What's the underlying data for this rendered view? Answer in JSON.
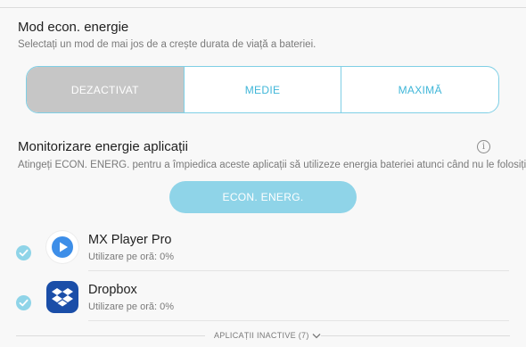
{
  "power_mode": {
    "title": "Mod econ. energie",
    "description": "Selectați un mod de mai jos de a crește durata de viață a bateriei.",
    "options": [
      {
        "label": "DEZACTIVAT",
        "selected": true
      },
      {
        "label": "MEDIE",
        "selected": false
      },
      {
        "label": "MAXIMĂ",
        "selected": false
      }
    ]
  },
  "app_monitor": {
    "title": "Monitorizare energie aplicații",
    "description": "Atingeți ECON. ENERG. pentru a împiedica aceste aplicații să utilizeze energia bateriei atunci când nu le folosiți.",
    "info_icon": "info-icon",
    "save_button_label": "ECON. ENERG."
  },
  "apps": [
    {
      "name": "MX Player Pro",
      "usage": "Utilizare pe oră: 0%",
      "checked": true,
      "icon": "play-icon"
    },
    {
      "name": "Dropbox",
      "usage": "Utilizare pe oră: 0%",
      "checked": true,
      "icon": "dropbox-icon"
    }
  ],
  "inactive_apps_label": "APLICAȚII INACTIVE (7)",
  "colors": {
    "accent": "#3fb6d8",
    "accent_light": "#8fd4e8",
    "selected_segment": "#c6c6c6",
    "mx_player_blue": "#3d8ee8",
    "dropbox_dark": "#1a4ea8"
  }
}
